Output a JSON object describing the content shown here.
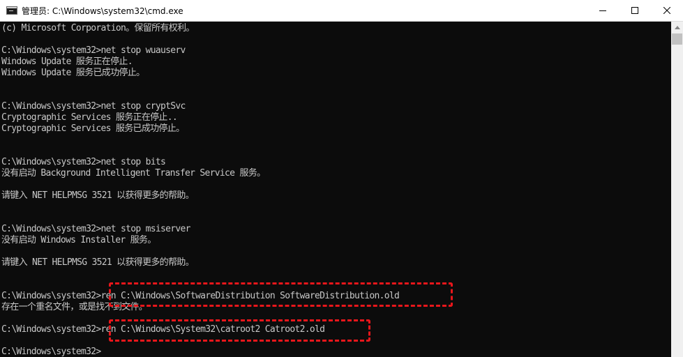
{
  "window": {
    "title": "管理员: C:\\Windows\\system32\\cmd.exe",
    "controls": {
      "minimize": "minimize-icon",
      "maximize": "maximize-icon",
      "close": "close-icon"
    }
  },
  "console": {
    "lines": [
      "(c) Microsoft Corporation。保留所有权利。",
      "",
      "C:\\Windows\\system32>net stop wuauserv",
      "Windows Update 服务正在停止.",
      "Windows Update 服务已成功停止。",
      "",
      "",
      "C:\\Windows\\system32>net stop cryptSvc",
      "Cryptographic Services 服务正在停止..",
      "Cryptographic Services 服务已成功停止。",
      "",
      "",
      "C:\\Windows\\system32>net stop bits",
      "没有启动 Background Intelligent Transfer Service 服务。",
      "",
      "请键入 NET HELPMSG 3521 以获得更多的帮助。",
      "",
      "",
      "C:\\Windows\\system32>net stop msiserver",
      "没有启动 Windows Installer 服务。",
      "",
      "请键入 NET HELPMSG 3521 以获得更多的帮助。",
      "",
      "",
      "C:\\Windows\\system32>ren C:\\Windows\\SoftwareDistribution SoftwareDistribution.old",
      "存在一个重名文件，或是找不到文件。",
      "",
      "C:\\Windows\\system32>ren C:\\Windows\\System32\\catroot2 Catroot2.old",
      "",
      "C:\\Windows\\system32>"
    ]
  },
  "colors": {
    "highlight": "#e8161b",
    "console_bg": "#0c0c0c",
    "console_text": "#c8c8c8"
  }
}
